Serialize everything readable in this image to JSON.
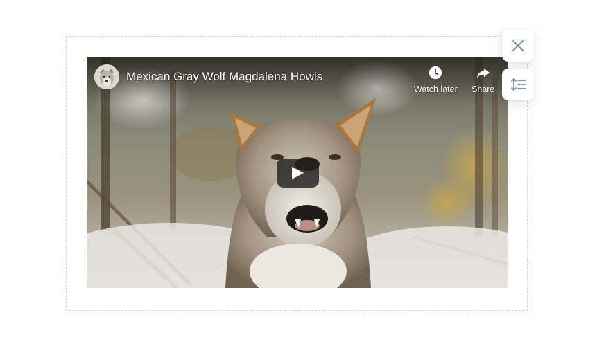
{
  "video": {
    "title": "Mexican Gray Wolf Magdalena Howls",
    "actions": {
      "watch_later": "Watch later",
      "share": "Share"
    }
  },
  "toolbar": {
    "buttons": [
      {
        "icon": "close-icon"
      },
      {
        "icon": "stretch-icon"
      }
    ]
  },
  "colors": {
    "dashed_border": "#c9d3dc",
    "side_icon": "#7b8a9a"
  }
}
